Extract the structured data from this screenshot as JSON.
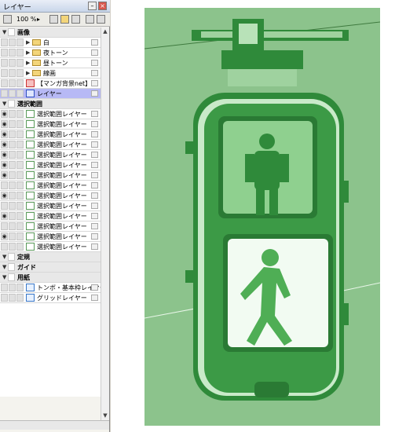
{
  "panel": {
    "title": "レイヤー",
    "zoom": "100 %"
  },
  "layers": [
    {
      "label": "画像",
      "kind": "group-header"
    },
    {
      "label": "白",
      "kind": "folder"
    },
    {
      "label": "夜トーン",
      "kind": "folder"
    },
    {
      "label": "昼トーン",
      "kind": "folder"
    },
    {
      "label": "線画",
      "kind": "folder"
    },
    {
      "label": "【マンガ背景net】",
      "kind": "layer"
    },
    {
      "label": "レイヤー",
      "kind": "selected"
    },
    {
      "label": "選択範囲",
      "kind": "group-header"
    },
    {
      "label": "選択範囲レイヤー",
      "kind": "sel",
      "eye": true
    },
    {
      "label": "選択範囲レイヤー",
      "kind": "sel",
      "eye": true
    },
    {
      "label": "選択範囲レイヤー",
      "kind": "sel",
      "eye": true
    },
    {
      "label": "選択範囲レイヤー",
      "kind": "sel",
      "eye": true
    },
    {
      "label": "選択範囲レイヤー",
      "kind": "sel",
      "eye": true
    },
    {
      "label": "選択範囲レイヤー",
      "kind": "sel",
      "eye": true
    },
    {
      "label": "選択範囲レイヤー",
      "kind": "sel",
      "eye": true
    },
    {
      "label": "選択範囲レイヤー",
      "kind": "sel",
      "eye": false
    },
    {
      "label": "選択範囲レイヤー",
      "kind": "sel",
      "eye": true
    },
    {
      "label": "選択範囲レイヤー",
      "kind": "sel",
      "eye": false
    },
    {
      "label": "選択範囲レイヤー",
      "kind": "sel",
      "eye": true
    },
    {
      "label": "選択範囲レイヤー",
      "kind": "sel",
      "eye": false
    },
    {
      "label": "選択範囲レイヤー",
      "kind": "sel",
      "eye": true
    },
    {
      "label": "選択範囲レイヤー",
      "kind": "sel",
      "eye": false
    },
    {
      "label": "定規",
      "kind": "group-header"
    },
    {
      "label": "ガイド",
      "kind": "group-header"
    },
    {
      "label": "用紙",
      "kind": "group-header"
    },
    {
      "label": "トンボ・基本枠レイヤー",
      "kind": "paper"
    },
    {
      "label": "グリッドレイヤー",
      "kind": "paper"
    }
  ],
  "colors": {
    "selected_row": "#b7b9f5",
    "art_background": "#8cc38c",
    "art_dark": "#2f8a3a"
  }
}
